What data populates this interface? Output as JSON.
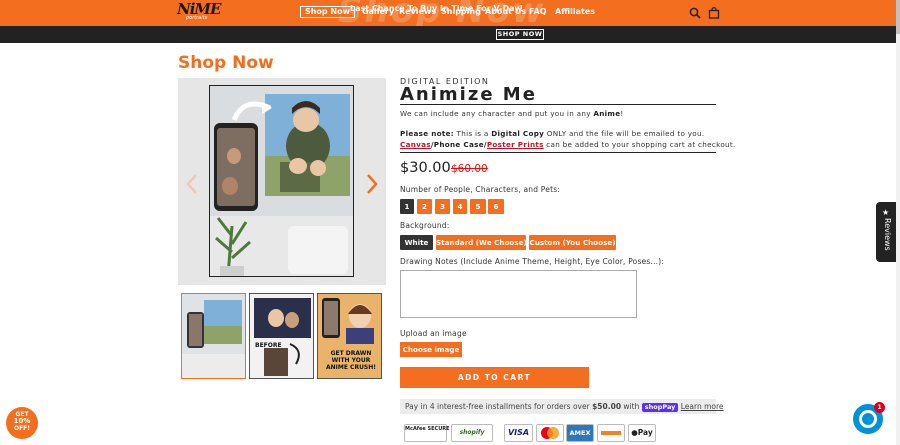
{
  "header": {
    "logo_text": "NiME",
    "logo_sub": "portraits",
    "ghost_text": "Shop Now",
    "nav": [
      {
        "label": "Shop Now"
      },
      {
        "label": "Gallery"
      },
      {
        "label": "Reviews"
      },
      {
        "label": "Shipping"
      },
      {
        "label": "About Us"
      },
      {
        "label": "FAQ"
      },
      {
        "label": "Affiliates"
      }
    ],
    "icons": [
      "search-icon",
      "shopping-bag-icon"
    ]
  },
  "announcement": {
    "text": "Last Chance To Buy In Time For V-Day!",
    "button": "SHOP NOW"
  },
  "page": {
    "title": "Shop Now"
  },
  "gallery": {
    "prev_icon": "chevron-left-icon",
    "next_icon": "chevron-right-icon",
    "thumb2_text": "BEFORE",
    "thumb3_text": "GET DRAWN WITH YOUR ANIME CRUSH!"
  },
  "product": {
    "edition": "DIGITAL EDITION",
    "name": "Animize Me",
    "desc_prefix": "We can include any character and put you in any ",
    "desc_bold": "Anime",
    "desc_suffix": "!",
    "note_label": "Please note:",
    "note_a": " This is a ",
    "note_bold": "Digital Copy",
    "note_b": " ONLY and the file will be emailed to you.",
    "link_canvas": "Canvas",
    "slash1": "/",
    "link_phone": "Phone Case",
    "slash2": "/",
    "link_poster": "Poster Prints",
    "note_c": " can be added to your shopping cart at checkout.",
    "price": "$30.00",
    "compare_price": "$60.00",
    "people_label": "Number of People, Characters, and Pets:",
    "people_options": [
      "1",
      "2",
      "3",
      "4",
      "5",
      "6"
    ],
    "people_selected": "1",
    "background_label": "Background:",
    "background_options": [
      "White",
      "Standard (We Choose)",
      "Custom (You Choose)"
    ],
    "background_selected": "White",
    "notes_label": "Drawing Notes (Include Anime Theme, Height, Eye Color, Poses...):",
    "notes_value": "",
    "upload_label": "Upload an image",
    "choose_button": "Choose image",
    "cart_button": "ADD TO CART",
    "installments_text": "Pay in 4 interest-free installments for orders over ",
    "installments_amount": "$50.00",
    "installments_with": " with ",
    "shoppay_label": "shopPay",
    "learn_more": "Learn more"
  },
  "badges": [
    "McAfee SECURE",
    "shopify",
    "VISA",
    "",
    "AMEX",
    "",
    "Pay"
  ],
  "widgets": {
    "promo_line1": "GET",
    "promo_line2": "10%",
    "promo_line3": "OFF!",
    "reviews_tab": "Reviews",
    "chat_count": "1"
  },
  "colors": {
    "brand": "#f36f1f",
    "dark": "#222222",
    "sale": "#d11111"
  }
}
